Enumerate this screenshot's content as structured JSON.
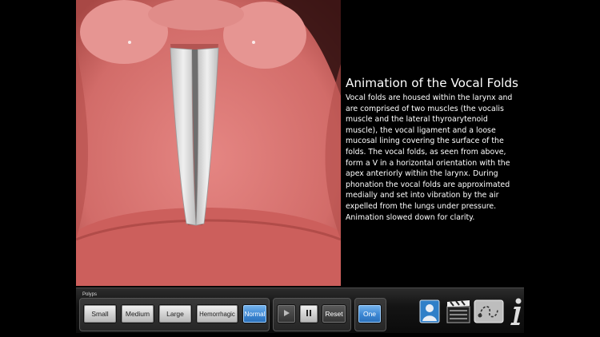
{
  "info": {
    "title": "Animation of the Vocal Folds",
    "description": "Vocal folds are housed within the larynx and are comprised of two muscles (the vocalis muscle and the lateral thyroarytenoid muscle), the vocal ligament and a loose mucosal lining covering the surface of the folds. The vocal folds, as seen from above, form a V in a horizontal orientation with the apex anteriorly within the larynx. During phonation the vocal folds are approximated medially and set into vibration by the air expelled from the lungs under pressure. Animation slowed down for clarity."
  },
  "toolbar": {
    "group_label": "Polyps",
    "polyp_buttons": [
      "Small",
      "Medium",
      "Large",
      "Hemorrhagic",
      "Normal"
    ],
    "selected_polyp": "Normal",
    "reset_label": "Reset",
    "one_label": "One"
  },
  "icons": {
    "play": "play-icon",
    "pause": "pause-icon",
    "portrait": "portrait-icon",
    "clapperboard": "clapperboard-icon",
    "path": "path-icon",
    "info": "info-icon"
  },
  "colors": {
    "accent": "#3b86d3",
    "tissue": "#d46c69",
    "fold": "#dcdcdc"
  }
}
